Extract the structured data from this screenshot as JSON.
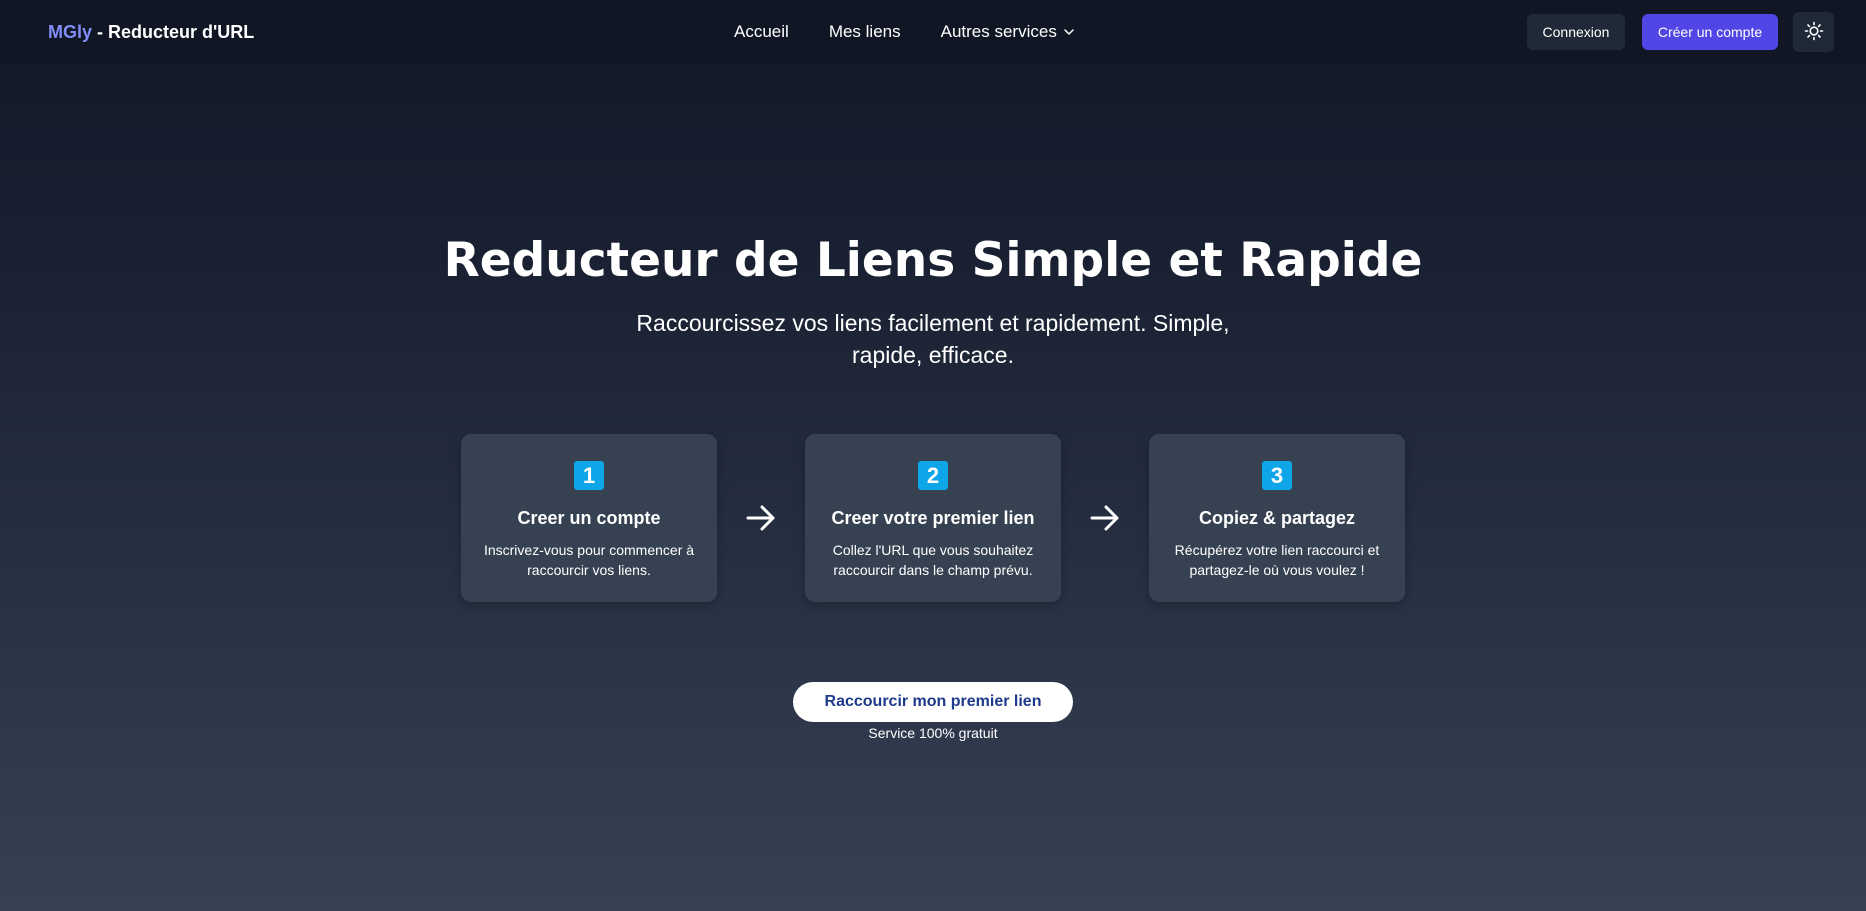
{
  "header": {
    "logo_brand": "MGly",
    "logo_rest": " - Reducteur d'URL",
    "nav": [
      {
        "label": "Accueil"
      },
      {
        "label": "Mes liens"
      },
      {
        "label": "Autres services"
      }
    ],
    "login_label": "Connexion",
    "signup_label": "Créer un compte",
    "theme_icon": "sun-icon"
  },
  "hero": {
    "title": "Reducteur de Liens Simple et Rapide",
    "subtitle": "Raccourcissez vos liens facilement et rapidement. Simple, rapide, efficace."
  },
  "steps": [
    {
      "number": "1",
      "title": "Creer un compte",
      "description": "Inscrivez-vous pour commencer à raccourcir vos liens."
    },
    {
      "number": "2",
      "title": "Creer votre premier lien",
      "description": "Collez l'URL que vous souhaitez raccourcir dans le champ prévu."
    },
    {
      "number": "3",
      "title": "Copiez & partagez",
      "description": "Récupérez votre lien raccourci et partagez-le où vous voulez !"
    }
  ],
  "cta": {
    "label": "Raccourcir mon premier lien",
    "note": "Service 100% gratuit"
  },
  "colors": {
    "accent": "#4f46e5",
    "brand": "#818cf8",
    "step_badge": "#0ea5e9",
    "cta_text": "#1e3a8a"
  }
}
